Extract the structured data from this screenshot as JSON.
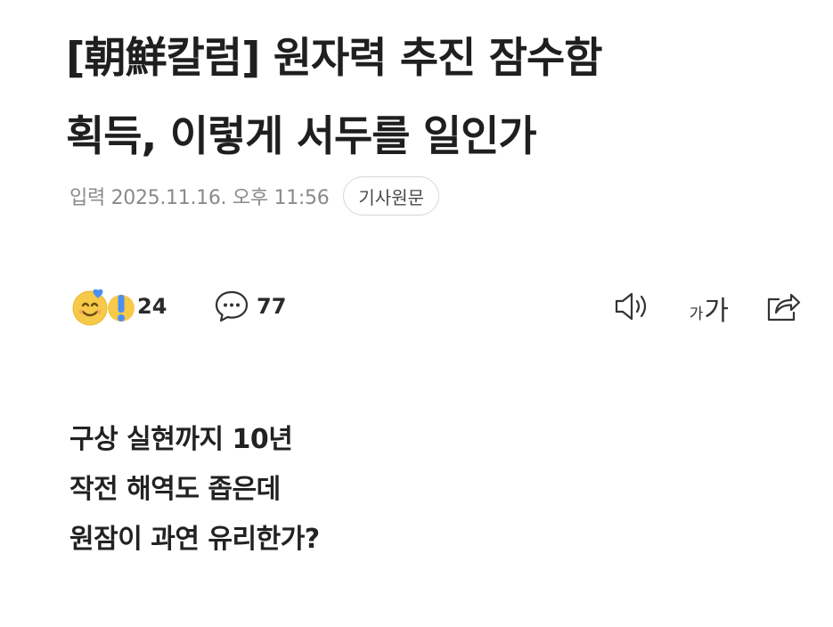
{
  "article": {
    "headline_line1": "[朝鮮칼럼] 원자력 추진 잠수함",
    "headline_line2": "획득, 이렇게 서두를 일인가",
    "published": "입력 2025.11.16. 오후 11:56",
    "origin_button": "기사원문"
  },
  "toolbar": {
    "reaction_count": "24",
    "comment_count": "77",
    "font_size_small": "가",
    "font_size_large": "가"
  },
  "subheads": [
    "구상 실현까지 10년",
    "작전 해역도 좁은데",
    "원잠이 과연 유리한가?"
  ],
  "icons": {
    "reaction": "smile-emoji-icon",
    "reaction_alt": "exclamation-emoji-icon",
    "comment": "speech-bubble-icon",
    "tts": "speaker-icon",
    "share": "share-icon"
  },
  "colors": {
    "text": "#1f1f1f",
    "meta": "#8a8a8a",
    "emoji_yellow": "#f7c948",
    "emoji_blue": "#4a8ff5"
  }
}
